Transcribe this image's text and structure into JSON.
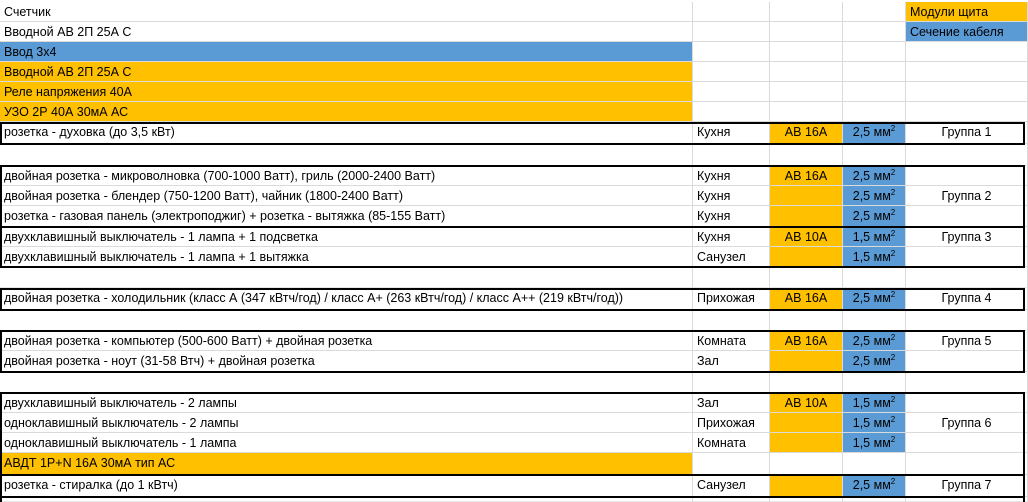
{
  "header": {
    "meter": "Счетчик",
    "intro_breaker": "Вводной АВ 2П 25А С",
    "input": "Ввод 3х4",
    "intro_breaker_2": "Вводной АВ 2П 25А С",
    "voltage_relay": "Реле напряжения 40А",
    "rcd": "УЗО 2Р 40А 30мА АС"
  },
  "legend": {
    "modules": "Модули щита",
    "cable_section": "Сечение кабеля"
  },
  "rows": [
    {
      "desc": "розетка - духовка (до 3,5 кВт)",
      "room": "Кухня",
      "breaker": "АВ 16А",
      "cable": "2,5 мм²",
      "group": "Группа 1"
    },
    {
      "desc": "двойная розетка - микроволновка (700-1000 Ватт), гриль (2000-2400 Ватт)",
      "room": "Кухня",
      "breaker": "АВ 16А",
      "cable": "2,5 мм²",
      "group": ""
    },
    {
      "desc": "двойная розетка - блендер (750-1200 Ватт), чайник (1800-2400 Ватт)",
      "room": "Кухня",
      "breaker": "",
      "cable": "2,5 мм²",
      "group": "Группа 2"
    },
    {
      "desc": "розетка - газовая панель (электроподжиг) + розетка - вытяжка (85-155 Ватт)",
      "room": "Кухня",
      "breaker": "",
      "cable": "2,5 мм²",
      "group": ""
    },
    {
      "desc": "двухклавишный выключатель - 1 лампа + 1 подсветка",
      "room": "Кухня",
      "breaker": "АВ 10А",
      "cable": "1,5 мм²",
      "group": "Группа 3"
    },
    {
      "desc": "двухклавишный выключатель - 1 лампа + 1 вытяжка",
      "room": "Санузел",
      "breaker": "",
      "cable": "1,5 мм²",
      "group": ""
    },
    {
      "desc": "двойная розетка - холодильник (класс А (347 кВтч/год) / класс А+ (263 кВтч/год) / класс А++ (219 кВтч/год))",
      "room": "Прихожая",
      "breaker": "АВ 16А",
      "cable": "2,5 мм²",
      "group": "Группа 4"
    },
    {
      "desc": "двойная розетка - компьютер (500-600 Ватт) + двойная розетка",
      "room": "Комната",
      "breaker": "АВ 16А",
      "cable": "2,5 мм²",
      "group": "Группа 5"
    },
    {
      "desc": "двойная розетка - ноут (31-58 Втч) + двойная розетка",
      "room": "Зал",
      "breaker": "",
      "cable": "2,5 мм²",
      "group": ""
    },
    {
      "desc": "двухклавишный выключатель - 2 лампы",
      "room": "Зал",
      "breaker": "АВ 10А",
      "cable": "1,5 мм²",
      "group": ""
    },
    {
      "desc": "одноклавишный выключатель - 2 лампы",
      "room": "Прихожая",
      "breaker": "",
      "cable": "1,5 мм²",
      "group": "Группа 6"
    },
    {
      "desc": "одноклавишный выключатель - 1 лампа",
      "room": "Комната",
      "breaker": "",
      "cable": "1,5 мм²",
      "group": ""
    },
    {
      "desc": "АВДТ 1P+N 16А 30мА тип АС",
      "room": "",
      "breaker": "",
      "cable": "",
      "group": ""
    },
    {
      "desc": "розетка - стиралка (до 1 кВтч)",
      "room": "Санузел",
      "breaker": "",
      "cable": "2,5 мм²",
      "group": "Группа 7"
    }
  ],
  "colors": {
    "orange": "#ffc000",
    "blue": "#5b9bd5"
  }
}
